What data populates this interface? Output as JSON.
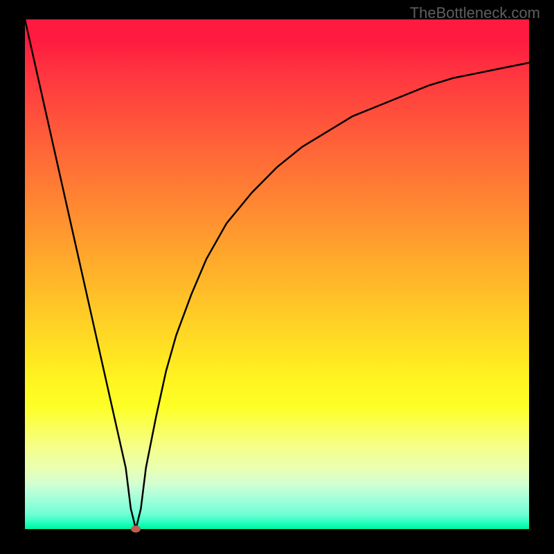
{
  "watermark": "TheBottleneck.com",
  "chart_data": {
    "type": "line",
    "title": "",
    "xlabel": "",
    "ylabel": "",
    "xlim": [
      0,
      100
    ],
    "ylim": [
      0,
      100
    ],
    "grid": false,
    "series": [
      {
        "name": "curve",
        "x": [
          0,
          5,
          10,
          15,
          20,
          21,
          22,
          23,
          24,
          26,
          28,
          30,
          33,
          36,
          40,
          45,
          50,
          55,
          60,
          65,
          70,
          75,
          80,
          85,
          90,
          95,
          100
        ],
        "values": [
          100,
          78,
          56,
          34,
          12,
          4,
          0,
          4,
          12,
          22,
          31,
          38,
          46,
          53,
          60,
          66,
          71,
          75,
          78,
          81,
          83,
          85,
          87,
          88.5,
          89.5,
          90.5,
          91.5
        ]
      }
    ],
    "marker": {
      "x": 22,
      "y": 0,
      "color": "#c35b4f"
    },
    "background": "rainbow-gradient-vertical"
  }
}
